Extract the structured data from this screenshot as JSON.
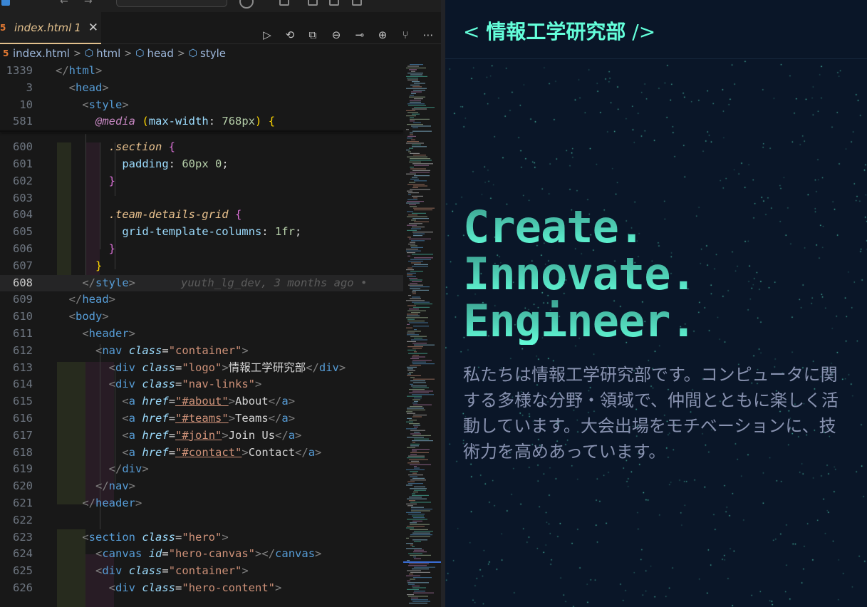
{
  "editor": {
    "tab": {
      "filename": "index.html",
      "badge": "1"
    },
    "breadcrumb": [
      "index.html",
      "html",
      "head",
      "style"
    ],
    "blame": "yuuth_lg_dev, 3 months ago •",
    "sticky": [
      {
        "n": "1339",
        "code": [
          [
            "p",
            "</"
          ],
          [
            "t",
            "html"
          ],
          [
            "p",
            ">"
          ]
        ]
      },
      {
        "n": "3",
        "code": [
          [
            "w",
            "  "
          ],
          [
            "p",
            "<"
          ],
          [
            "t",
            "head"
          ],
          [
            "p",
            ">"
          ]
        ]
      },
      {
        "n": "10",
        "code": [
          [
            "w",
            "    "
          ],
          [
            "p",
            "<"
          ],
          [
            "t",
            "style"
          ],
          [
            "p",
            ">"
          ]
        ]
      },
      {
        "n": "581",
        "code": [
          [
            "w",
            "      "
          ],
          [
            "at",
            "@media"
          ],
          [
            "w",
            " "
          ],
          [
            "b1",
            "("
          ],
          [
            "prop",
            "max-width"
          ],
          [
            "w",
            ": "
          ],
          [
            "num",
            "768px"
          ],
          [
            "b1",
            ")"
          ],
          [
            "w",
            " "
          ],
          [
            "b1",
            "{"
          ]
        ]
      }
    ],
    "lines": [
      {
        "n": "600",
        "code": [
          [
            "w",
            "        "
          ],
          [
            "sel",
            ".section"
          ],
          [
            "w",
            " "
          ],
          [
            "b2",
            "{"
          ]
        ]
      },
      {
        "n": "601",
        "code": [
          [
            "w",
            "          "
          ],
          [
            "prop",
            "padding"
          ],
          [
            "w",
            ": "
          ],
          [
            "num",
            "60px"
          ],
          [
            "w",
            " "
          ],
          [
            "num",
            "0"
          ],
          [
            "w",
            ";"
          ]
        ]
      },
      {
        "n": "602",
        "code": [
          [
            "w",
            "        "
          ],
          [
            "b2",
            "}"
          ]
        ]
      },
      {
        "n": "603",
        "code": []
      },
      {
        "n": "604",
        "code": [
          [
            "w",
            "        "
          ],
          [
            "sel",
            ".team-details-grid"
          ],
          [
            "w",
            " "
          ],
          [
            "b2",
            "{"
          ]
        ]
      },
      {
        "n": "605",
        "code": [
          [
            "w",
            "          "
          ],
          [
            "prop",
            "grid-template-columns"
          ],
          [
            "w",
            ": "
          ],
          [
            "num",
            "1fr"
          ],
          [
            "w",
            ";"
          ]
        ]
      },
      {
        "n": "606",
        "code": [
          [
            "w",
            "        "
          ],
          [
            "b2",
            "}"
          ]
        ]
      },
      {
        "n": "607",
        "code": [
          [
            "w",
            "      "
          ],
          [
            "b1",
            "}"
          ]
        ]
      },
      {
        "n": "608",
        "code": [
          [
            "w",
            "    "
          ],
          [
            "p",
            "</"
          ],
          [
            "t",
            "style"
          ],
          [
            "p",
            ">"
          ]
        ],
        "current": true
      },
      {
        "n": "609",
        "code": [
          [
            "w",
            "  "
          ],
          [
            "p",
            "</"
          ],
          [
            "t",
            "head"
          ],
          [
            "p",
            ">"
          ]
        ]
      },
      {
        "n": "610",
        "code": [
          [
            "w",
            "  "
          ],
          [
            "p",
            "<"
          ],
          [
            "t",
            "body"
          ],
          [
            "p",
            ">"
          ]
        ]
      },
      {
        "n": "611",
        "code": [
          [
            "w",
            "    "
          ],
          [
            "p",
            "<"
          ],
          [
            "t",
            "header"
          ],
          [
            "p",
            ">"
          ]
        ]
      },
      {
        "n": "612",
        "code": [
          [
            "w",
            "      "
          ],
          [
            "p",
            "<"
          ],
          [
            "t",
            "nav"
          ],
          [
            "w",
            " "
          ],
          [
            "a",
            "class"
          ],
          [
            "w",
            "="
          ],
          [
            "s",
            "\"container\""
          ],
          [
            "p",
            ">"
          ]
        ]
      },
      {
        "n": "613",
        "code": [
          [
            "w",
            "        "
          ],
          [
            "p",
            "<"
          ],
          [
            "t",
            "div"
          ],
          [
            "w",
            " "
          ],
          [
            "a",
            "class"
          ],
          [
            "w",
            "="
          ],
          [
            "s",
            "\"logo\""
          ],
          [
            "p",
            ">"
          ],
          [
            "w",
            "情報工学研究部"
          ],
          [
            "p",
            "</"
          ],
          [
            "t",
            "div"
          ],
          [
            "p",
            ">"
          ]
        ]
      },
      {
        "n": "614",
        "code": [
          [
            "w",
            "        "
          ],
          [
            "p",
            "<"
          ],
          [
            "t",
            "div"
          ],
          [
            "w",
            " "
          ],
          [
            "a",
            "class"
          ],
          [
            "w",
            "="
          ],
          [
            "s",
            "\"nav-links\""
          ],
          [
            "p",
            ">"
          ]
        ]
      },
      {
        "n": "615",
        "code": [
          [
            "w",
            "          "
          ],
          [
            "p",
            "<"
          ],
          [
            "t",
            "a"
          ],
          [
            "w",
            " "
          ],
          [
            "a",
            "href"
          ],
          [
            "w",
            "="
          ],
          [
            "su",
            "\"#about\""
          ],
          [
            "p",
            ">"
          ],
          [
            "w",
            "About"
          ],
          [
            "p",
            "</"
          ],
          [
            "t",
            "a"
          ],
          [
            "p",
            ">"
          ]
        ]
      },
      {
        "n": "616",
        "code": [
          [
            "w",
            "          "
          ],
          [
            "p",
            "<"
          ],
          [
            "t",
            "a"
          ],
          [
            "w",
            " "
          ],
          [
            "a",
            "href"
          ],
          [
            "w",
            "="
          ],
          [
            "su",
            "\"#teams\""
          ],
          [
            "p",
            ">"
          ],
          [
            "w",
            "Teams"
          ],
          [
            "p",
            "</"
          ],
          [
            "t",
            "a"
          ],
          [
            "p",
            ">"
          ]
        ]
      },
      {
        "n": "617",
        "code": [
          [
            "w",
            "          "
          ],
          [
            "p",
            "<"
          ],
          [
            "t",
            "a"
          ],
          [
            "w",
            " "
          ],
          [
            "a",
            "href"
          ],
          [
            "w",
            "="
          ],
          [
            "su",
            "\"#join\""
          ],
          [
            "p",
            ">"
          ],
          [
            "w",
            "Join Us"
          ],
          [
            "p",
            "</"
          ],
          [
            "t",
            "a"
          ],
          [
            "p",
            ">"
          ]
        ]
      },
      {
        "n": "618",
        "code": [
          [
            "w",
            "          "
          ],
          [
            "p",
            "<"
          ],
          [
            "t",
            "a"
          ],
          [
            "w",
            " "
          ],
          [
            "a",
            "href"
          ],
          [
            "w",
            "="
          ],
          [
            "su",
            "\"#contact\""
          ],
          [
            "p",
            ">"
          ],
          [
            "w",
            "Contact"
          ],
          [
            "p",
            "</"
          ],
          [
            "t",
            "a"
          ],
          [
            "p",
            ">"
          ]
        ]
      },
      {
        "n": "619",
        "code": [
          [
            "w",
            "        "
          ],
          [
            "p",
            "</"
          ],
          [
            "t",
            "div"
          ],
          [
            "p",
            ">"
          ]
        ]
      },
      {
        "n": "620",
        "code": [
          [
            "w",
            "      "
          ],
          [
            "p",
            "</"
          ],
          [
            "t",
            "nav"
          ],
          [
            "p",
            ">"
          ]
        ]
      },
      {
        "n": "621",
        "code": [
          [
            "w",
            "    "
          ],
          [
            "p",
            "</"
          ],
          [
            "t",
            "header"
          ],
          [
            "p",
            ">"
          ]
        ]
      },
      {
        "n": "622",
        "code": []
      },
      {
        "n": "623",
        "code": [
          [
            "w",
            "    "
          ],
          [
            "p",
            "<"
          ],
          [
            "t",
            "section"
          ],
          [
            "w",
            " "
          ],
          [
            "a",
            "class"
          ],
          [
            "w",
            "="
          ],
          [
            "s",
            "\"hero\""
          ],
          [
            "p",
            ">"
          ]
        ]
      },
      {
        "n": "624",
        "code": [
          [
            "w",
            "      "
          ],
          [
            "p",
            "<"
          ],
          [
            "t",
            "canvas"
          ],
          [
            "w",
            " "
          ],
          [
            "a",
            "id"
          ],
          [
            "w",
            "="
          ],
          [
            "s",
            "\"hero-canvas\""
          ],
          [
            "p",
            "></"
          ],
          [
            "t",
            "canvas"
          ],
          [
            "p",
            ">"
          ]
        ]
      },
      {
        "n": "625",
        "code": [
          [
            "w",
            "      "
          ],
          [
            "p",
            "<"
          ],
          [
            "t",
            "div"
          ],
          [
            "w",
            " "
          ],
          [
            "a",
            "class"
          ],
          [
            "w",
            "="
          ],
          [
            "s",
            "\"container\""
          ],
          [
            "p",
            ">"
          ]
        ]
      },
      {
        "n": "626",
        "code": [
          [
            "w",
            "        "
          ],
          [
            "p",
            "<"
          ],
          [
            "t",
            "div"
          ],
          [
            "w",
            " "
          ],
          [
            "a",
            "class"
          ],
          [
            "w",
            "="
          ],
          [
            "s",
            "\"hero-content\""
          ],
          [
            "p",
            ">"
          ]
        ]
      }
    ]
  },
  "preview": {
    "logo": {
      "open": "< ",
      "text": "情報工学研究部",
      "close": " />"
    },
    "hero_lines": [
      "Create.",
      "Innovate.",
      "Engineer."
    ],
    "description": "私たちは情報工学研究部です。コンピュータに関する多様な分野・領域で、仲間とともに楽しく活動しています。大会出場をモチベーションに、技術力を高めあっています。",
    "colors": {
      "accent": "#64ffda",
      "background": "#0a1628",
      "text_muted": "#8892b0"
    }
  }
}
